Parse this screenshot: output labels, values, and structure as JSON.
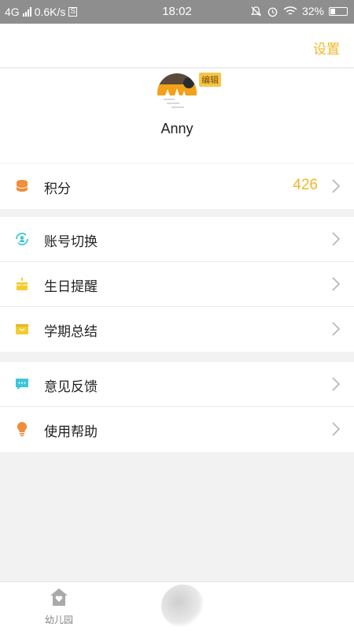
{
  "status_bar": {
    "network": "4G",
    "speed": "0.6K/s",
    "s_badge": "S",
    "time": "18:02",
    "battery_percent": "32%",
    "battery_level": 0.32
  },
  "header": {
    "settings_label": "设置"
  },
  "profile": {
    "edit_label": "编辑",
    "username": "Anny"
  },
  "menu": {
    "points": {
      "label": "积分",
      "value": "426",
      "icon": "coins-stack-icon",
      "icon_color": "#f08c3a"
    },
    "group2": [
      {
        "label": "账号切换",
        "icon": "account-switch-icon",
        "icon_color": "#3cc7d9"
      },
      {
        "label": "生日提醒",
        "icon": "birthday-cake-icon",
        "icon_color": "#f5cc2e"
      },
      {
        "label": "学期总结",
        "icon": "folder-box-icon",
        "icon_color": "#f5cc2e"
      }
    ],
    "group3": [
      {
        "label": "意见反馈",
        "icon": "feedback-chat-icon",
        "icon_color": "#3cc7d9"
      },
      {
        "label": "使用帮助",
        "icon": "lightbulb-icon",
        "icon_color": "#f08c3a"
      }
    ]
  },
  "tabbar": {
    "items": [
      {
        "label": "幼儿园",
        "icon": "kindergarten-house-icon"
      }
    ]
  },
  "colors": {
    "accent": "#f0b729",
    "status_bar": "#8e8e8e"
  }
}
